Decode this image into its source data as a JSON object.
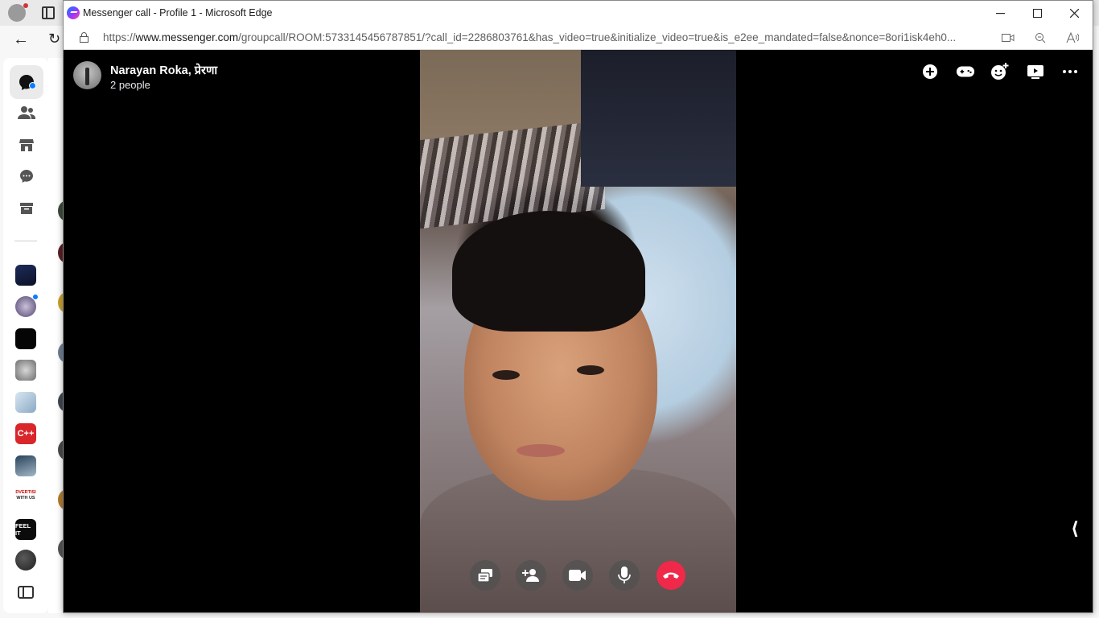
{
  "window": {
    "title": "Messenger call - Profile 1 - Microsoft Edge",
    "url_prefix": "https://",
    "url_host": "www.messenger.com",
    "url_rest": "/groupcall/ROOM:5733145456787851/?call_id=2286803761&has_video=true&initialize_video=true&is_e2ee_mandated=false&nonce=8ori1isk4eh0..."
  },
  "call": {
    "caller_name": "Narayan Roka, प्रेरणा",
    "participants": "2 people"
  },
  "top_actions": [
    {
      "name": "add-icon"
    },
    {
      "name": "game-icon"
    },
    {
      "name": "add-effect-icon"
    },
    {
      "name": "watch-together-icon"
    },
    {
      "name": "more-options-icon"
    }
  ],
  "controls": [
    {
      "name": "share-screen-button"
    },
    {
      "name": "add-person-button"
    },
    {
      "name": "camera-button"
    },
    {
      "name": "microphone-button"
    },
    {
      "name": "end-call-button"
    }
  ],
  "sidebar": {
    "nav_icons": [
      "chats-icon",
      "people-icon",
      "marketplace-icon",
      "message-requests-icon",
      "archive-icon"
    ],
    "chats": [
      "chat-1",
      "chat-2",
      "chat-3",
      "chat-4",
      "chat-5",
      "chat-6",
      "chat-7",
      "chat-8",
      "chat-9",
      "chat-10"
    ],
    "chat_texts": {
      "c8_line1": "DVERTISI",
      "c8_line2": "WITH US",
      "c9": "FEEL IT",
      "c6": "C++"
    }
  },
  "colors": {
    "end_call": "#f02849",
    "accent": "#0a7cff"
  }
}
